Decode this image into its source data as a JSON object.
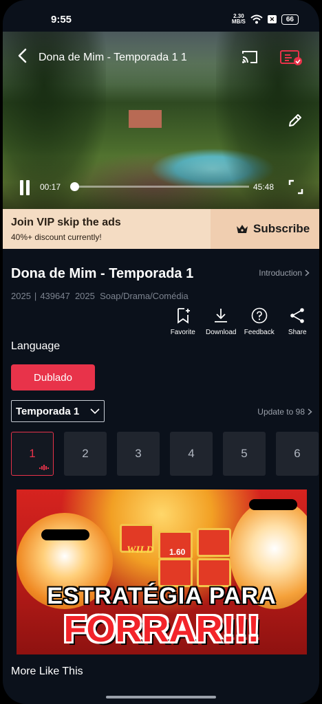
{
  "status_bar": {
    "time": "9:55",
    "net_speed_value": "2.30",
    "net_speed_unit": "MB/S",
    "battery": "66"
  },
  "player": {
    "title": "Dona de Mim - Temporada 1 1",
    "current_time": "00:17",
    "total_time": "45:48",
    "progress_fraction": 0.006,
    "icons": [
      "back-icon",
      "cast-icon",
      "record-icon",
      "edit-icon",
      "pause-icon",
      "fullscreen-icon"
    ]
  },
  "vip_banner": {
    "title": "Join VIP skip the ads",
    "subtitle": "40%+ discount currently!",
    "subscribe_label": "Subscribe"
  },
  "show": {
    "title": "Dona de Mim - Temporada 1",
    "intro_label": "Introduction",
    "year": "2025",
    "views": "439647",
    "year2": "2025",
    "genres": "Soap/Drama/Comédia"
  },
  "actions": [
    {
      "label": "Favorite",
      "icon": "favorite-icon"
    },
    {
      "label": "Download",
      "icon": "download-icon"
    },
    {
      "label": "Feedback",
      "icon": "feedback-icon"
    },
    {
      "label": "Share",
      "icon": "share-icon"
    }
  ],
  "language": {
    "label": "Language",
    "selected": "Dublado"
  },
  "season": {
    "selected": "Temporada 1",
    "update_label": "Update to 98"
  },
  "episodes": [
    "1",
    "2",
    "3",
    "4",
    "5",
    "6"
  ],
  "ad": {
    "line1": "ESTRATÉGIA PARA",
    "line2": "FORRAR!!!",
    "tile_wild": "WILD",
    "tile_value": "1.60"
  },
  "more_like_label": "More Like This",
  "colors": {
    "accent": "#e8334a",
    "background": "#0b111b",
    "vip_bg": "#f4dcc3"
  }
}
